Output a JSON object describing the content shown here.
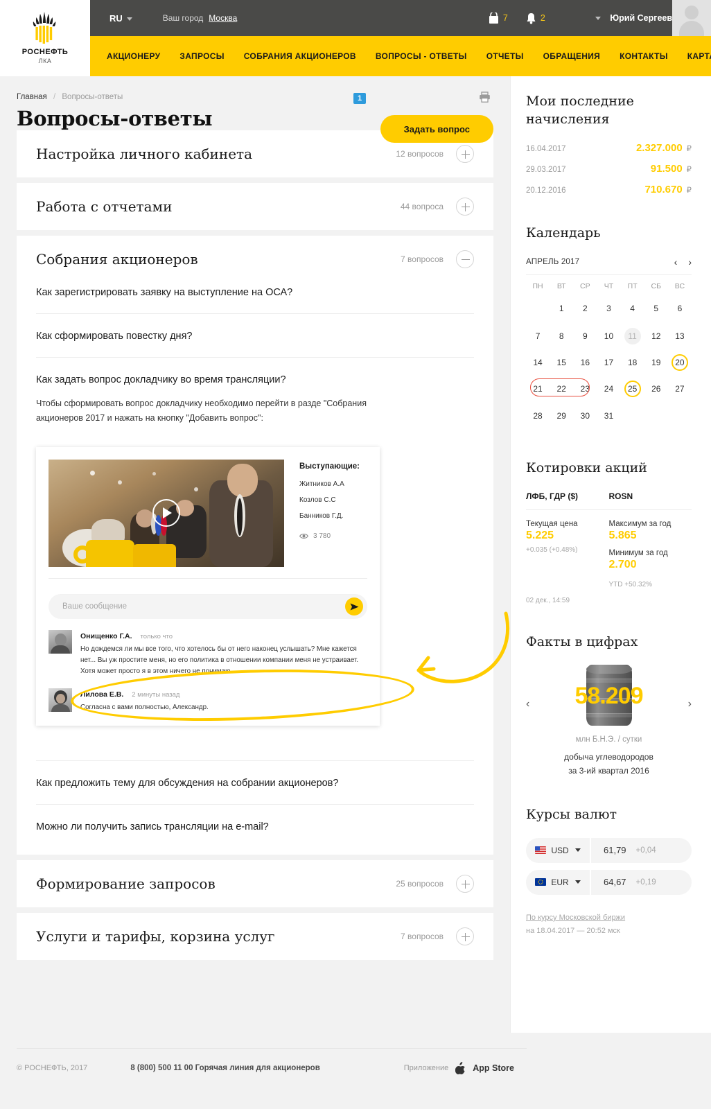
{
  "header": {
    "logo_name": "РОСНЕФТЬ",
    "logo_sub": "ЛКА",
    "lang": "RU",
    "city_label": "Ваш город",
    "city_value": "Москва",
    "cart_count": "7",
    "bell_count": "2",
    "user_name": "Юрий Сергеевич",
    "nav": [
      "АКЦИОНЕРУ",
      "ЗАПРОСЫ",
      "СОБРАНИЯ АКЦИОНЕРОВ",
      "ВОПРОСЫ - ОТВЕТЫ",
      "ОТЧЕТЫ",
      "ОБРАЩЕНИЯ",
      "КОНТАКТЫ",
      "КАРТА ЛКА"
    ]
  },
  "breadcrumb": {
    "home": "Главная",
    "current": "Вопросы-ответы"
  },
  "page": {
    "title": "Вопросы-ответы",
    "badge": "1",
    "ask_button": "Задать вопрос"
  },
  "accordions": [
    {
      "title": "Настройка личного кабинета",
      "count": "12 вопросов",
      "open": false
    },
    {
      "title": "Работа с отчетами",
      "count": "44 вопроса",
      "open": false
    },
    {
      "title": "Собрания акционеров",
      "count": "7 вопросов",
      "open": true
    },
    {
      "title": "Формирование запросов",
      "count": "25 вопросов",
      "open": false
    },
    {
      "title": "Услуги и тарифы, корзина услуг",
      "count": "7 вопросов",
      "open": false
    }
  ],
  "questions": {
    "q1": "Как зарегистрировать заявку на выступление на ОСА?",
    "q2": "Как сформировать повестку дня?",
    "q3": "Как задать вопрос докладчику во время трансляции?",
    "q3_answer": "Чтобы сформировать вопрос докладчику необходимо перейти в разде \"Собрания акционеров 2017 и нажать на кнопку \"Добавить вопрос\":",
    "q4": "Как предложить тему для обсуждения на собрании акционеров?",
    "q5": "Можно ли получить запись трансляции на e-mail?"
  },
  "demo": {
    "speakers_title": "Выступающие:",
    "speakers": [
      "Житников А.А",
      "Козлов С.С",
      "Банников Г.Д."
    ],
    "views": "3 780",
    "message_placeholder": "Ваше сообщение",
    "comments": [
      {
        "name": "Онищенко Г.А.",
        "time": "только что",
        "text": "Но дождемся ли мы все того, что хотелось бы от него наконец услышать? Мне кажется нет... Вы уж простите меня, но его политика в отношении компании меня не устраивает. Хотя может просто я в этом ничего не понимаю."
      },
      {
        "name": "Лилова Е.В.",
        "time": "2 минуты назад",
        "text": "Согласна с вами полностью, Александр."
      }
    ]
  },
  "sidebar": {
    "accruals_title": "Мои последние начисления",
    "accruals": [
      {
        "date": "16.04.2017",
        "amount": "2.327.000",
        "currency": "₽"
      },
      {
        "date": "29.03.2017",
        "amount": "91.500",
        "currency": "₽"
      },
      {
        "date": "20.12.2016",
        "amount": "710.670",
        "currency": "₽"
      }
    ],
    "calendar_title": "Календарь",
    "calendar": {
      "month": "АПРЕЛЬ 2017",
      "weekdays": [
        "ПН",
        "ВТ",
        "СР",
        "ЧТ",
        "ПТ",
        "СБ",
        "ВС"
      ],
      "weeks": [
        [
          "",
          "1",
          "2",
          "3",
          "4",
          "5",
          "6"
        ],
        [
          "7",
          "8",
          "9",
          "10",
          "11",
          "12",
          "13"
        ],
        [
          "14",
          "15",
          "16",
          "17",
          "18",
          "19",
          "20"
        ],
        [
          "21",
          "22",
          "23",
          "24",
          "25",
          "26",
          "27"
        ],
        [
          "28",
          "29",
          "30",
          "31",
          "",
          "",
          ""
        ]
      ],
      "today": "11",
      "ringed": [
        "20",
        "25"
      ],
      "range": [
        "21",
        "22",
        "23"
      ]
    },
    "quotes_title": "Котировки акций",
    "quotes": {
      "left_header": "ЛФБ, ГДР ($)",
      "right_header": "ROSN",
      "current_label": "Текущая цена",
      "current_value": "5.225",
      "current_delta": "+0.035 (+0.48%)",
      "max_label": "Максимум за год",
      "max_value": "5.865",
      "min_label": "Минимум за год",
      "min_value": "2.700",
      "time": "02 дек., 14:59",
      "ytd": "YTD +50.32%"
    },
    "facts_title": "Факты в цифрах",
    "facts": {
      "number": "58.209",
      "unit": "млн Б.Н.Э. / сутки",
      "desc_line1": "добыча углеводородов",
      "desc_line2": "за 3-ий квартал 2016"
    },
    "currency_title": "Курсы валют",
    "currencies": [
      {
        "code": "USD",
        "value": "61,79",
        "delta": "+0,04"
      },
      {
        "code": "EUR",
        "value": "64,67",
        "delta": "+0,19"
      }
    ],
    "currency_note_1": "По курсу Московской биржи",
    "currency_note_2": "на 18.04.2017 — 20:52 мск"
  },
  "footer": {
    "copyright": "©  РОСНЕФТЬ, 2017",
    "phone": "8 (800) 500 11 00  Горячая линия для акционеров",
    "app_label": "Приложение",
    "store": "App Store"
  },
  "colors": {
    "brand_yellow": "#ffcc00",
    "dark": "#4a4a48",
    "badge_blue": "#2e9bdc",
    "range_red": "#e74c3c"
  }
}
